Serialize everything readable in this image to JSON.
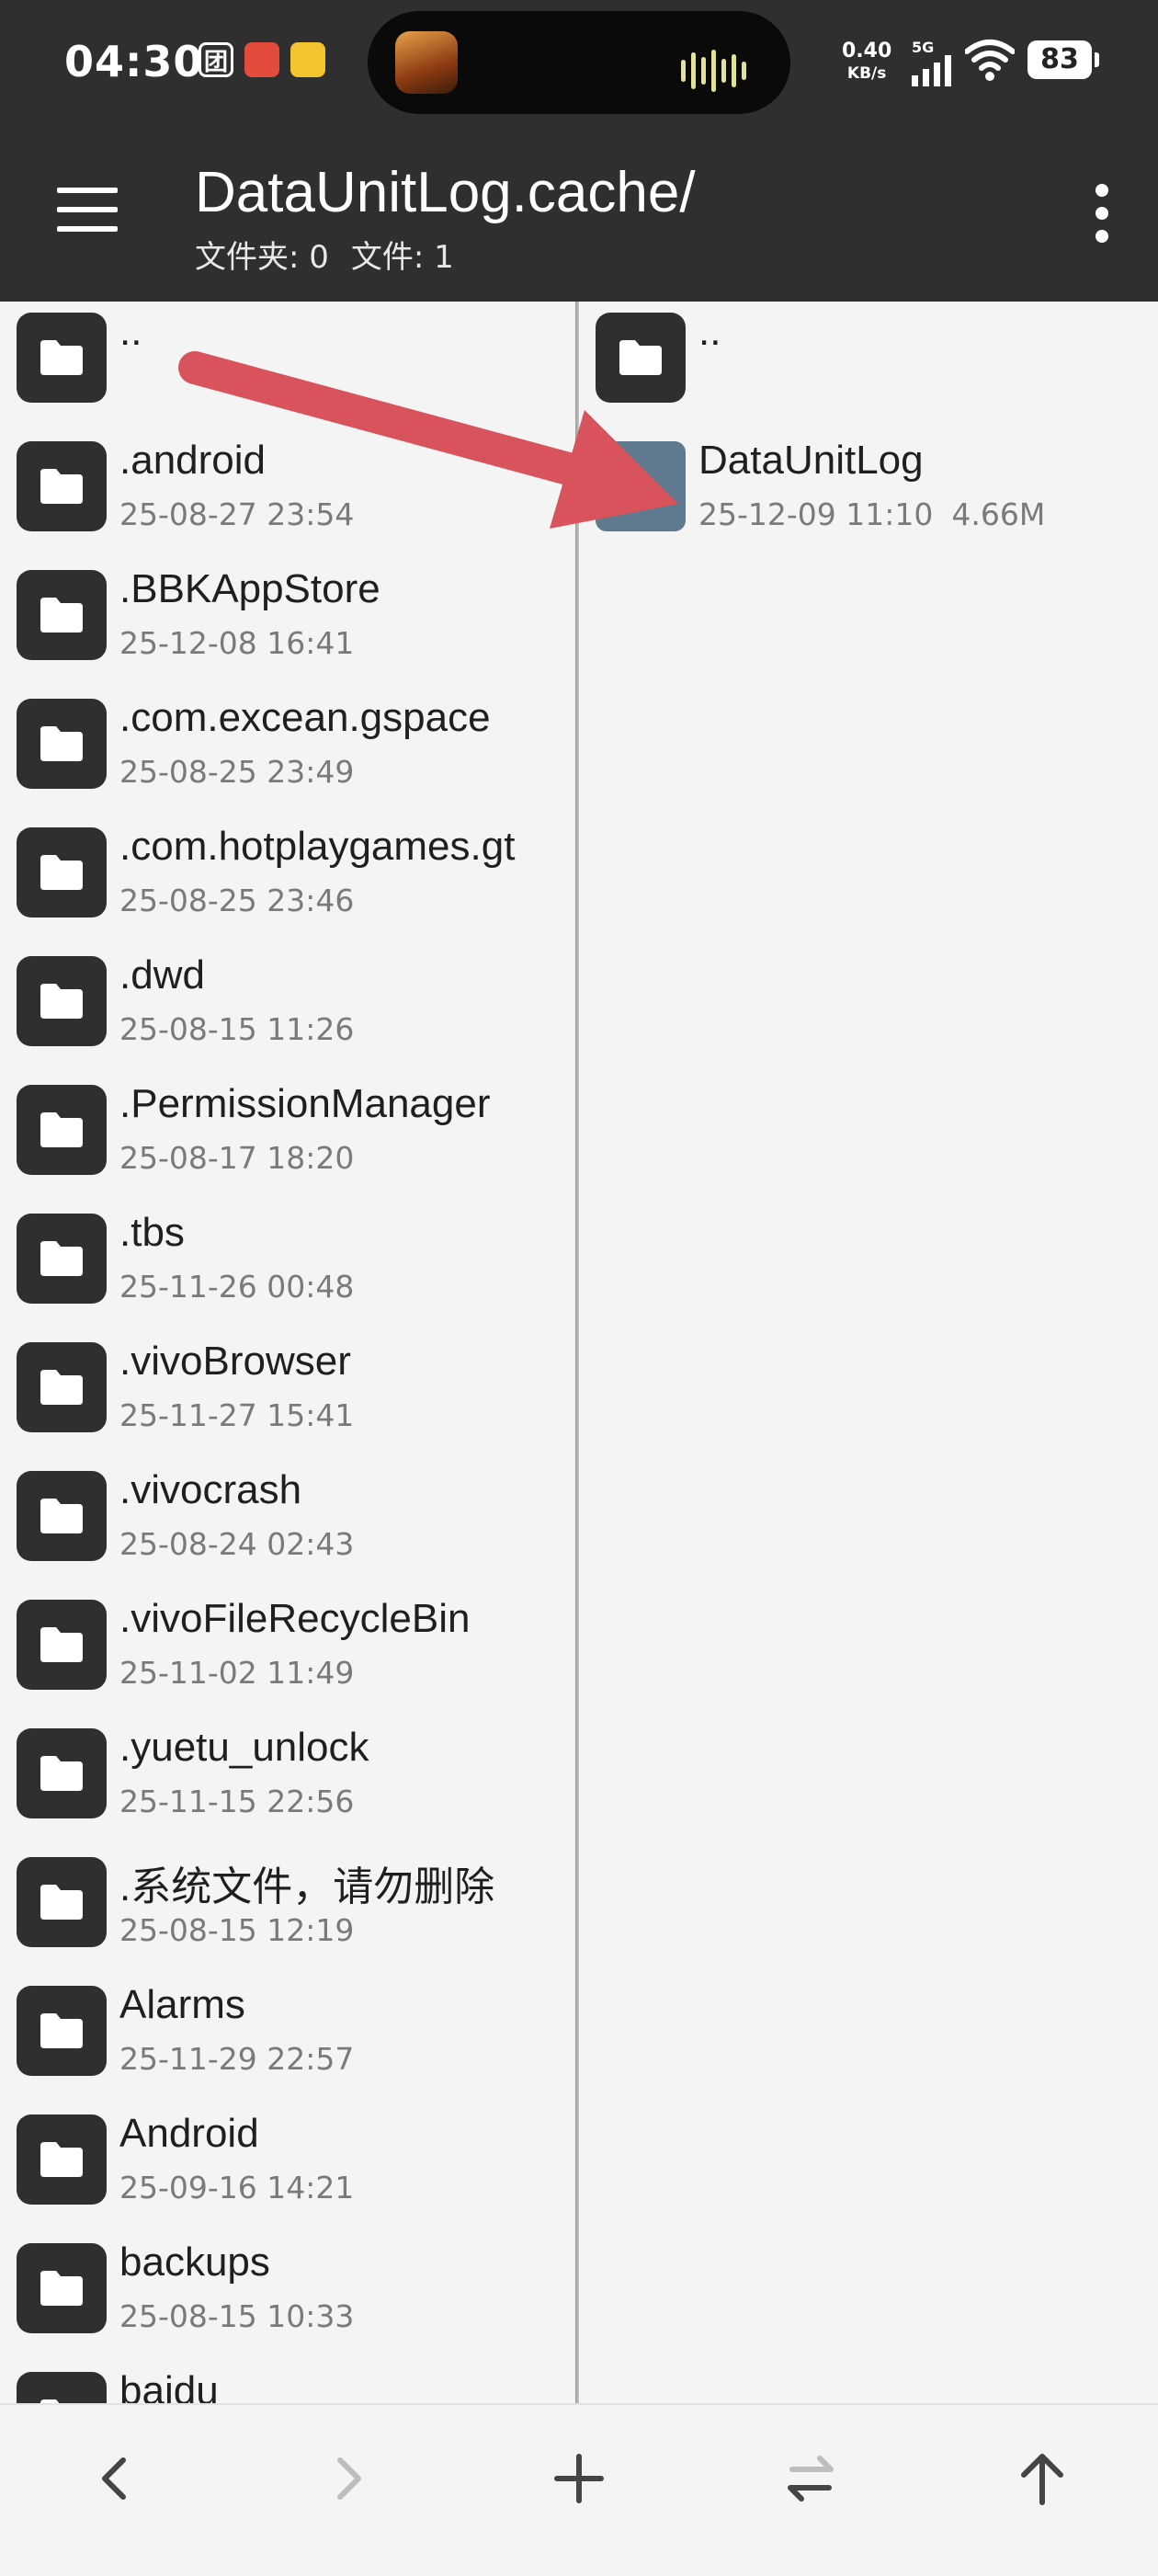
{
  "status_bar": {
    "time": "04:30",
    "app_icons": [
      "团"
    ],
    "net_speed_value": "0.40",
    "net_speed_unit": "KB/s",
    "network": "5G",
    "battery": "83"
  },
  "app_bar": {
    "title": "DataUnitLog.cache/",
    "folder_count_label": "文件夹: 0",
    "file_count_label": "文件: 1",
    "menu_icon": "hamburger-icon",
    "more_icon": "more-vert-icon"
  },
  "left_pane": {
    "parent_label": "..",
    "items": [
      {
        "name": ".android",
        "date": "25-08-27 23:54"
      },
      {
        "name": ".BBKAppStore",
        "date": "25-12-08 16:41"
      },
      {
        "name": ".com.excean.gspace",
        "date": "25-08-25 23:49"
      },
      {
        "name": ".com.hotplaygames.gt",
        "date": "25-08-25 23:46"
      },
      {
        "name": ".dwd",
        "date": "25-08-15 11:26"
      },
      {
        "name": ".PermissionManager",
        "date": "25-08-17 18:20"
      },
      {
        "name": ".tbs",
        "date": "25-11-26 00:48"
      },
      {
        "name": ".vivoBrowser",
        "date": "25-11-27 15:41"
      },
      {
        "name": ".vivocrash",
        "date": "25-08-24 02:43"
      },
      {
        "name": ".vivoFileRecycleBin",
        "date": "25-11-02 11:49"
      },
      {
        "name": ".yuetu_unlock",
        "date": "25-11-15 22:56"
      },
      {
        "name": ".系统文件，请勿删除",
        "date": "25-08-15 12:19"
      },
      {
        "name": "Alarms",
        "date": "25-11-29 22:57"
      },
      {
        "name": "Android",
        "date": "25-09-16 14:21"
      },
      {
        "name": "backups",
        "date": "25-08-15 10:33"
      },
      {
        "name": "baidu",
        "date": ""
      }
    ]
  },
  "right_pane": {
    "parent_label": "..",
    "items": [
      {
        "name": "DataUnitLog",
        "date": "25-12-09 11:10",
        "size": "4.66M",
        "type": "file"
      }
    ]
  },
  "annotation": {
    "color": "#d9535c"
  },
  "bottom_bar": {
    "buttons": [
      "back-icon",
      "forward-icon",
      "add-icon",
      "swap-icon",
      "up-icon"
    ]
  }
}
